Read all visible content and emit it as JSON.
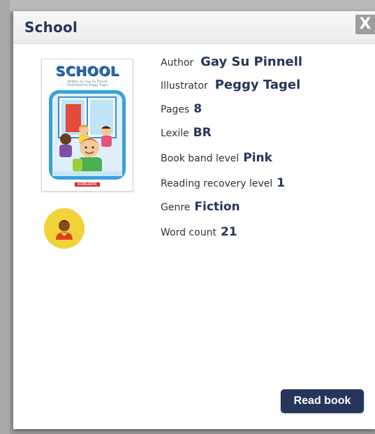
{
  "dialog": {
    "title": "School",
    "close_label": "X"
  },
  "cover": {
    "title": "SCHOOL",
    "written_by": "Written by Gay Su Pinnell",
    "illustrated_by": "Illustrated by Peggy Tagel",
    "publisher": "SCHOLASTIC"
  },
  "details": [
    {
      "label": "Author",
      "value": "Gay Su Pinnell"
    },
    {
      "label": "Illustrator",
      "value": "Peggy Tagel"
    },
    {
      "label": "Pages",
      "value": "8"
    },
    {
      "label": "Lexile",
      "value": "BR"
    },
    {
      "label": "Book band level",
      "value": "Pink"
    },
    {
      "label": "Reading recovery level",
      "value": "1"
    },
    {
      "label": "Genre",
      "value": "Fiction"
    },
    {
      "label": "Word count",
      "value": "21"
    }
  ],
  "actions": {
    "read_label": "Read book"
  },
  "colors": {
    "navy": "#26355a",
    "avatar_bg": "#f2d33a",
    "close_bg": "#9c9c9c"
  },
  "icons": {
    "avatar": "reader-avatar-icon",
    "close": "close-icon"
  }
}
